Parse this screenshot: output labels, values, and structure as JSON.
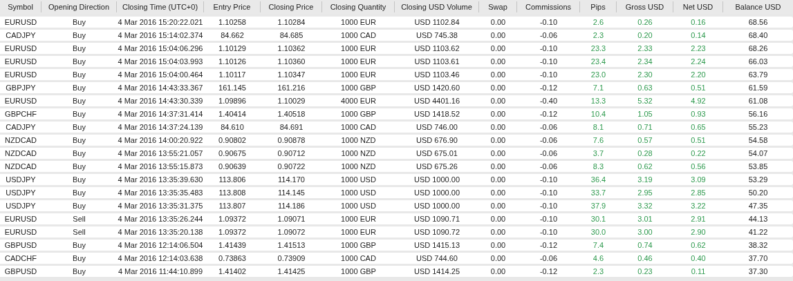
{
  "table": {
    "columns": [
      {
        "label": "Symbol",
        "kind": "plain"
      },
      {
        "label": "Opening Direction",
        "kind": "plain"
      },
      {
        "label": "Closing Time (UTC+0)",
        "kind": "plain"
      },
      {
        "label": "Entry Price",
        "kind": "plain"
      },
      {
        "label": "Closing Price",
        "kind": "plain"
      },
      {
        "label": "Closing Quantity",
        "kind": "plain"
      },
      {
        "label": "Closing USD Volume",
        "kind": "plain"
      },
      {
        "label": "Swap",
        "kind": "plain"
      },
      {
        "label": "Commissions",
        "kind": "plain"
      },
      {
        "label": "Pips",
        "kind": "profit"
      },
      {
        "label": "Gross USD",
        "kind": "profit"
      },
      {
        "label": "Net USD",
        "kind": "profit"
      },
      {
        "label": "Balance USD",
        "kind": "plain"
      }
    ],
    "rows": [
      [
        "EURUSD",
        "Buy",
        "4 Mar 2016 15:20:22.021",
        "1.10258",
        "1.10284",
        "1000 EUR",
        "USD 1102.84",
        "0.00",
        "-0.10",
        "2.6",
        "0.26",
        "0.16",
        "68.56"
      ],
      [
        "CADJPY",
        "Buy",
        "4 Mar 2016 15:14:02.374",
        "84.662",
        "84.685",
        "1000 CAD",
        "USD 745.38",
        "0.00",
        "-0.06",
        "2.3",
        "0.20",
        "0.14",
        "68.40"
      ],
      [
        "EURUSD",
        "Buy",
        "4 Mar 2016 15:04:06.296",
        "1.10129",
        "1.10362",
        "1000 EUR",
        "USD 1103.62",
        "0.00",
        "-0.10",
        "23.3",
        "2.33",
        "2.23",
        "68.26"
      ],
      [
        "EURUSD",
        "Buy",
        "4 Mar 2016 15:04:03.993",
        "1.10126",
        "1.10360",
        "1000 EUR",
        "USD 1103.61",
        "0.00",
        "-0.10",
        "23.4",
        "2.34",
        "2.24",
        "66.03"
      ],
      [
        "EURUSD",
        "Buy",
        "4 Mar 2016 15:04:00.464",
        "1.10117",
        "1.10347",
        "1000 EUR",
        "USD 1103.46",
        "0.00",
        "-0.10",
        "23.0",
        "2.30",
        "2.20",
        "63.79"
      ],
      [
        "GBPJPY",
        "Buy",
        "4 Mar 2016 14:43:33.367",
        "161.145",
        "161.216",
        "1000 GBP",
        "USD 1420.60",
        "0.00",
        "-0.12",
        "7.1",
        "0.63",
        "0.51",
        "61.59"
      ],
      [
        "EURUSD",
        "Buy",
        "4 Mar 2016 14:43:30.339",
        "1.09896",
        "1.10029",
        "4000 EUR",
        "USD 4401.16",
        "0.00",
        "-0.40",
        "13.3",
        "5.32",
        "4.92",
        "61.08"
      ],
      [
        "GBPCHF",
        "Buy",
        "4 Mar 2016 14:37:31.414",
        "1.40414",
        "1.40518",
        "1000 GBP",
        "USD 1418.52",
        "0.00",
        "-0.12",
        "10.4",
        "1.05",
        "0.93",
        "56.16"
      ],
      [
        "CADJPY",
        "Buy",
        "4 Mar 2016 14:37:24.139",
        "84.610",
        "84.691",
        "1000 CAD",
        "USD 746.00",
        "0.00",
        "-0.06",
        "8.1",
        "0.71",
        "0.65",
        "55.23"
      ],
      [
        "NZDCAD",
        "Buy",
        "4 Mar 2016 14:00:20.922",
        "0.90802",
        "0.90878",
        "1000 NZD",
        "USD 676.90",
        "0.00",
        "-0.06",
        "7.6",
        "0.57",
        "0.51",
        "54.58"
      ],
      [
        "NZDCAD",
        "Buy",
        "4 Mar 2016 13:55:21.057",
        "0.90675",
        "0.90712",
        "1000 NZD",
        "USD 675.01",
        "0.00",
        "-0.06",
        "3.7",
        "0.28",
        "0.22",
        "54.07"
      ],
      [
        "NZDCAD",
        "Buy",
        "4 Mar 2016 13:55:15.873",
        "0.90639",
        "0.90722",
        "1000 NZD",
        "USD 675.26",
        "0.00",
        "-0.06",
        "8.3",
        "0.62",
        "0.56",
        "53.85"
      ],
      [
        "USDJPY",
        "Buy",
        "4 Mar 2016 13:35:39.630",
        "113.806",
        "114.170",
        "1000 USD",
        "USD 1000.00",
        "0.00",
        "-0.10",
        "36.4",
        "3.19",
        "3.09",
        "53.29"
      ],
      [
        "USDJPY",
        "Buy",
        "4 Mar 2016 13:35:35.483",
        "113.808",
        "114.145",
        "1000 USD",
        "USD 1000.00",
        "0.00",
        "-0.10",
        "33.7",
        "2.95",
        "2.85",
        "50.20"
      ],
      [
        "USDJPY",
        "Buy",
        "4 Mar 2016 13:35:31.375",
        "113.807",
        "114.186",
        "1000 USD",
        "USD 1000.00",
        "0.00",
        "-0.10",
        "37.9",
        "3.32",
        "3.22",
        "47.35"
      ],
      [
        "EURUSD",
        "Sell",
        "4 Mar 2016 13:35:26.244",
        "1.09372",
        "1.09071",
        "1000 EUR",
        "USD 1090.71",
        "0.00",
        "-0.10",
        "30.1",
        "3.01",
        "2.91",
        "44.13"
      ],
      [
        "EURUSD",
        "Sell",
        "4 Mar 2016 13:35:20.138",
        "1.09372",
        "1.09072",
        "1000 EUR",
        "USD 1090.72",
        "0.00",
        "-0.10",
        "30.0",
        "3.00",
        "2.90",
        "41.22"
      ],
      [
        "GBPUSD",
        "Buy",
        "4 Mar 2016 12:14:06.504",
        "1.41439",
        "1.41513",
        "1000 GBP",
        "USD 1415.13",
        "0.00",
        "-0.12",
        "7.4",
        "0.74",
        "0.62",
        "38.32"
      ],
      [
        "CADCHF",
        "Buy",
        "4 Mar 2016 12:14:03.638",
        "0.73863",
        "0.73909",
        "1000 CAD",
        "USD 744.60",
        "0.00",
        "-0.06",
        "4.6",
        "0.46",
        "0.40",
        "37.70"
      ],
      [
        "GBPUSD",
        "Buy",
        "4 Mar 2016 11:44:10.899",
        "1.41402",
        "1.41425",
        "1000 GBP",
        "USD 1414.25",
        "0.00",
        "-0.12",
        "2.3",
        "0.23",
        "0.11",
        "37.30"
      ]
    ]
  }
}
